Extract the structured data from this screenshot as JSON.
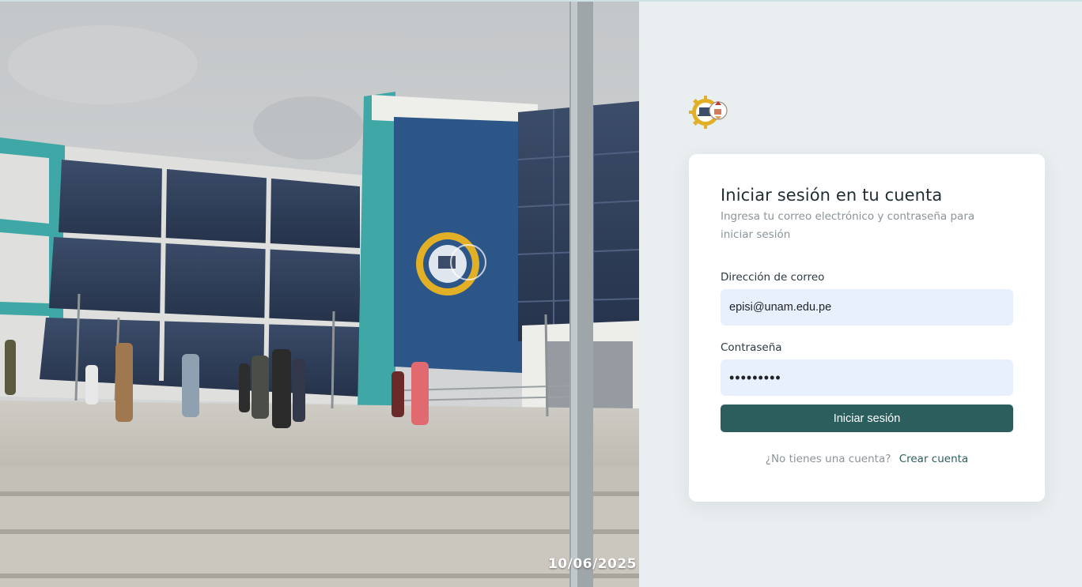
{
  "photo": {
    "date_stamp": "10/06/2025"
  },
  "logo": {
    "icon": "faculty-gear-logo-icon"
  },
  "login": {
    "title": "Iniciar sesión en tu cuenta",
    "subtitle": "Ingresa tu correo electrónico y contraseña para iniciar sesión",
    "email_label": "Dirección de correo",
    "email_value": "episi@unam.edu.pe",
    "password_label": "Contraseña",
    "password_value": "•••••••••",
    "submit_label": "Iniciar sesión",
    "signup_question": "¿No tienes una cuenta?",
    "signup_link": "Crear cuenta"
  },
  "colors": {
    "page_background": "#e9eef0",
    "card_background": "#ffffff",
    "primary": "#2d5e5e",
    "input_background": "#e8f0fe",
    "title_text": "#1f2d33",
    "muted_text": "#8a9499"
  }
}
